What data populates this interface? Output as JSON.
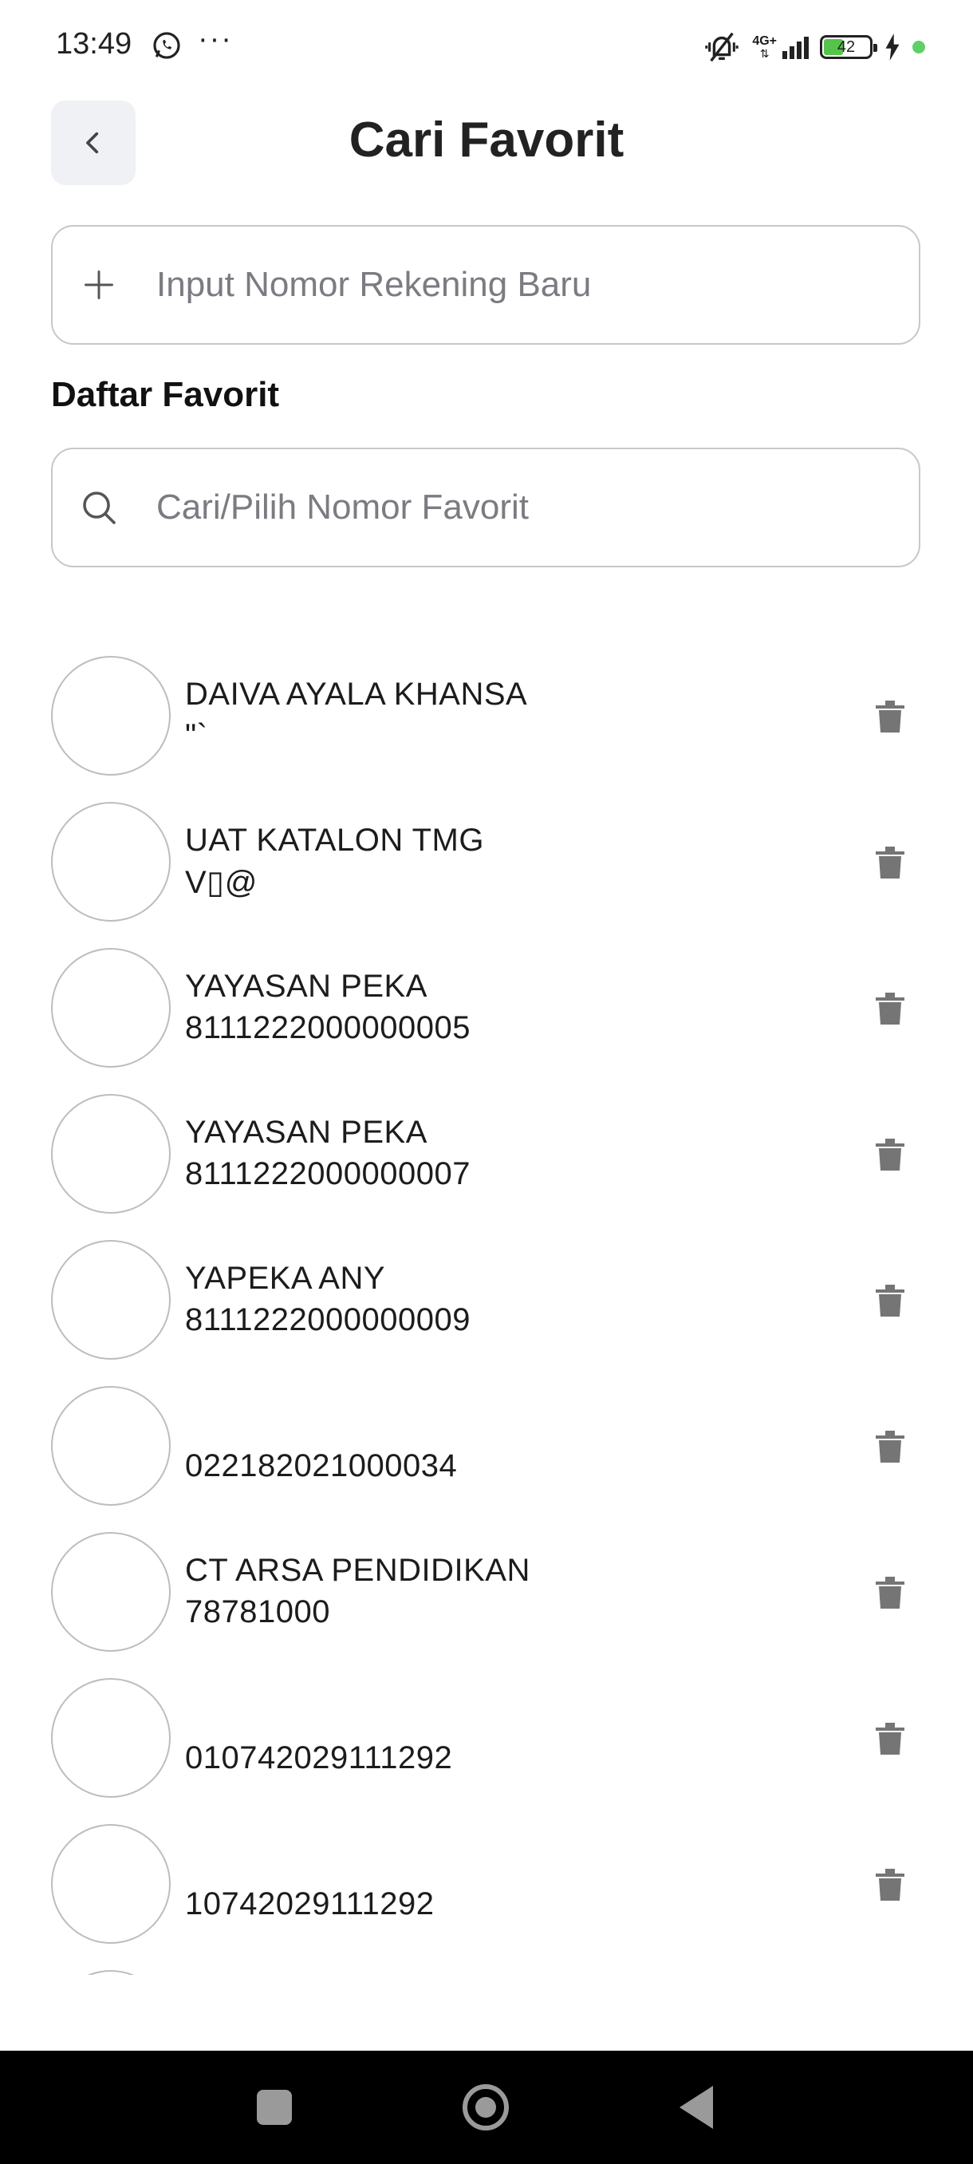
{
  "status_bar": {
    "time": "13:49",
    "overflow": "···",
    "network": "4G+",
    "battery": "42",
    "battery_level_percent": 42,
    "icons": [
      "whatsapp-icon",
      "mute-vibrate-icon",
      "signal-icon",
      "battery-icon",
      "charging-icon"
    ]
  },
  "header": {
    "title": "Cari Favorit",
    "back_icon": "chevron-left-icon"
  },
  "new_account": {
    "placeholder": "Input Nomor Rekening Baru",
    "icon": "plus-icon"
  },
  "favorites": {
    "section_label": "Daftar Favorit",
    "search_placeholder": "Cari/Pilih Nomor Favorit",
    "search_icon": "search-icon",
    "items": [
      {
        "name": "DAIVA AYALA KHANSA",
        "number": "\"`"
      },
      {
        "name": "UAT KATALON TMG",
        "number": "V▯@"
      },
      {
        "name": "YAYASAN PEKA",
        "number": "8111222000000005"
      },
      {
        "name": "YAYASAN PEKA",
        "number": "8111222000000007"
      },
      {
        "name": "YAPEKA ANY",
        "number": "8111222000000009"
      },
      {
        "name": "",
        "number": "022182021000034"
      },
      {
        "name": "CT ARSA PENDIDIKAN",
        "number": "78781000"
      },
      {
        "name": "",
        "number": "010742029111292"
      },
      {
        "name": "",
        "number": "10742029111292"
      },
      {
        "name": "",
        "number": ""
      }
    ]
  },
  "colors": {
    "accent_green": "#5fd067",
    "border": "#c7c7cc",
    "icon_gray": "#757575"
  }
}
